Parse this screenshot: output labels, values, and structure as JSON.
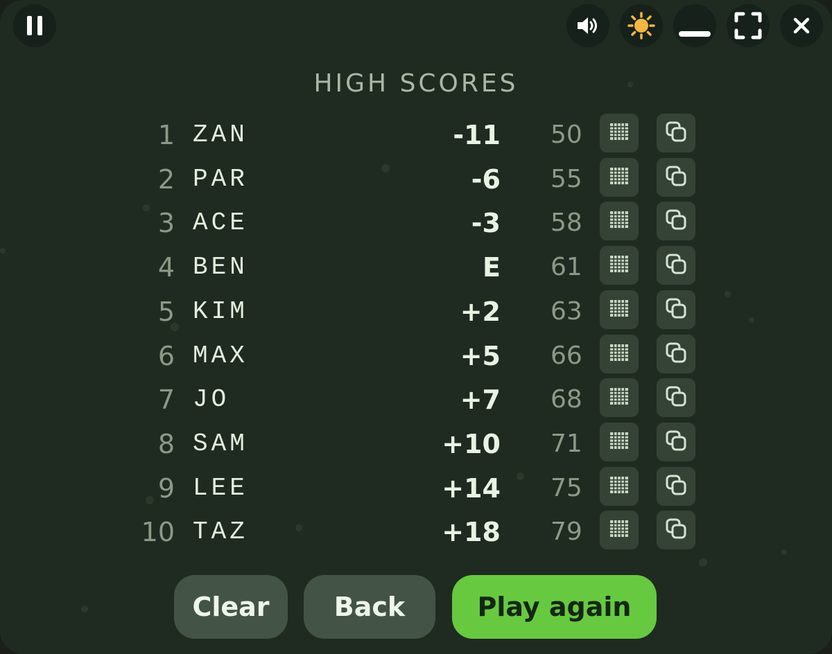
{
  "toolbar": {
    "pause_icon": "pause-icon",
    "sound_icon": "speaker-icon",
    "theme_icon": "sun-icon",
    "minimize_icon": "minimize-icon",
    "fullscreen_icon": "fullscreen-icon",
    "close_icon": "close-icon"
  },
  "title": "HIGH SCORES",
  "scores": [
    {
      "rank": "1",
      "name": "ZAN",
      "score": "-11",
      "strokes": "50"
    },
    {
      "rank": "2",
      "name": "PAR",
      "score": "-6",
      "strokes": "55"
    },
    {
      "rank": "3",
      "name": "ACE",
      "score": "-3",
      "strokes": "58"
    },
    {
      "rank": "4",
      "name": "BEN",
      "score": "E",
      "strokes": "61"
    },
    {
      "rank": "5",
      "name": "KIM",
      "score": "+2",
      "strokes": "63"
    },
    {
      "rank": "6",
      "name": "MAX",
      "score": "+5",
      "strokes": "66"
    },
    {
      "rank": "7",
      "name": "JO",
      "score": "+7",
      "strokes": "68"
    },
    {
      "rank": "8",
      "name": "SAM",
      "score": "+10",
      "strokes": "71"
    },
    {
      "rank": "9",
      "name": "LEE",
      "score": "+14",
      "strokes": "75"
    },
    {
      "rank": "10",
      "name": "TAZ",
      "score": "+18",
      "strokes": "79"
    }
  ],
  "row_icons": {
    "scorecard": "scorecard-grid-icon",
    "copy": "copy-icon"
  },
  "buttons": {
    "clear": "Clear",
    "back": "Back",
    "play_again": "Play again"
  },
  "colors": {
    "background": "#1f2b20",
    "accent": "#67c940",
    "sun": "#f5b642"
  }
}
